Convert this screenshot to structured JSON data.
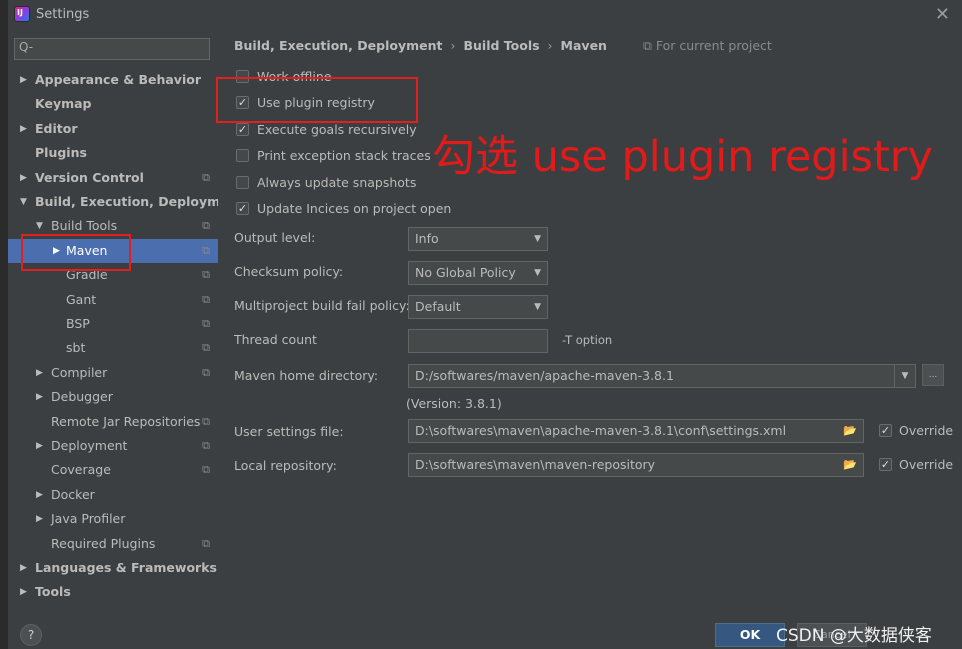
{
  "window": {
    "title": "Settings"
  },
  "search": {
    "placeholder": "Q-"
  },
  "tree": [
    {
      "label": "Appearance & Behavior",
      "arrow": "▶"
    },
    {
      "label": "Keymap",
      "arrow": ""
    },
    {
      "label": "Editor",
      "arrow": "▶"
    },
    {
      "label": "Plugins",
      "arrow": ""
    },
    {
      "label": "Version Control",
      "arrow": "▶"
    },
    {
      "label": "Build, Execution, Deployment",
      "arrow": "▼"
    },
    {
      "label": "Build Tools",
      "arrow": "▼"
    },
    {
      "label": "Maven",
      "arrow": "▶"
    },
    {
      "label": "Gradle",
      "arrow": ""
    },
    {
      "label": "Gant",
      "arrow": ""
    },
    {
      "label": "BSP",
      "arrow": ""
    },
    {
      "label": "sbt",
      "arrow": ""
    },
    {
      "label": "Compiler",
      "arrow": "▶"
    },
    {
      "label": "Debugger",
      "arrow": "▶"
    },
    {
      "label": "Remote Jar Repositories",
      "arrow": ""
    },
    {
      "label": "Deployment",
      "arrow": "▶"
    },
    {
      "label": "Coverage",
      "arrow": ""
    },
    {
      "label": "Docker",
      "arrow": "▶"
    },
    {
      "label": "Java Profiler",
      "arrow": "▶"
    },
    {
      "label": "Required Plugins",
      "arrow": ""
    },
    {
      "label": "Languages & Frameworks",
      "arrow": "▶"
    },
    {
      "label": "Tools",
      "arrow": "▶"
    }
  ],
  "breadcrumb": {
    "part1": "Build, Execution, Deployment",
    "part2": "Build Tools",
    "part3": "Maven",
    "separator": "›",
    "scope": "⧉ For current project"
  },
  "checkboxes": [
    {
      "label": "Work offline",
      "checked": false
    },
    {
      "label": "Use plugin registry",
      "checked": true
    },
    {
      "label": "Execute goals recursively",
      "checked": true
    },
    {
      "label": "Print exception stack traces",
      "checked": false
    },
    {
      "label": "Always update snapshots",
      "checked": false
    },
    {
      "label": "Update Incices on project open",
      "checked": true
    }
  ],
  "form": {
    "output_level": {
      "label": "Output level:",
      "value": "Info"
    },
    "checksum_policy": {
      "label": "Checksum policy:",
      "value": "No Global Policy"
    },
    "multiproject": {
      "label": "Multiproject build fail policy:",
      "value": "Default"
    },
    "thread_count": {
      "label": "Thread count",
      "value": "",
      "hint": "-T option"
    },
    "maven_home": {
      "label": "Maven home directory:",
      "value": "D:/softwares/maven/apache-maven-3.8.1",
      "browse": "..."
    },
    "version": "(Version: 3.8.1)",
    "user_settings": {
      "label": "User settings file:",
      "value": "D:\\softwares\\maven\\apache-maven-3.8.1\\conf\\settings.xml",
      "override": "Override",
      "override_checked": true
    },
    "local_repo": {
      "label": "Local repository:",
      "value": "D:\\softwares\\maven\\maven-repository",
      "override": "Override",
      "override_checked": true
    }
  },
  "footer": {
    "help": "?",
    "ok": "OK",
    "cancel": "Cancel"
  },
  "annotation": {
    "text": "勾选 use plugin registry",
    "color": "#e21a1a"
  },
  "watermark": "CSDN @大数据侠客",
  "colors": {
    "background": "#3c3f41",
    "selection": "#4b6eaf",
    "ok": "#365880",
    "annotation_red": "#e0201f"
  }
}
